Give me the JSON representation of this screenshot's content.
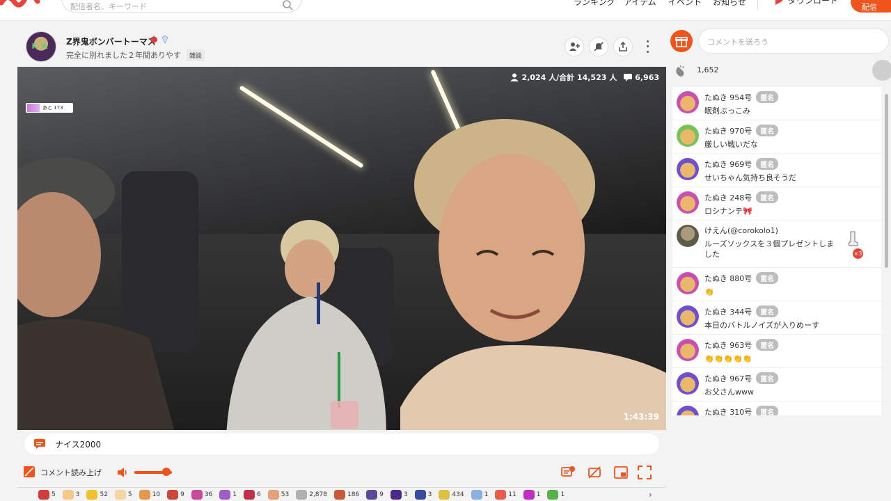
{
  "header": {
    "search_placeholder": "配信者名、キーワード",
    "nav": [
      "ランキング",
      "アイテム",
      "イベント",
      "お知らせ"
    ],
    "download_label": "ダウンロード",
    "live_label": "配信"
  },
  "streamer": {
    "name": "Z界鬼ボンバートーマス",
    "title": "完全に別れました２年間ありやす",
    "genre": "雑談"
  },
  "video": {
    "viewers": "2,024 人/合計 14,523 人",
    "comments": "6,963",
    "badge_text": "あと 173",
    "elapsed": "1:43:39"
  },
  "ticker_comment": "ナイス2000",
  "controls": {
    "read_aloud_label": "コメント読み上げ",
    "volume_level": 0.85
  },
  "items": [
    {
      "icon": "#d23c3c",
      "count": "5"
    },
    {
      "icon": "#f3c88a",
      "count": "3"
    },
    {
      "icon": "#f0c230",
      "count": "52"
    },
    {
      "icon": "#f6d6a0",
      "count": "5"
    },
    {
      "icon": "#e39a4b",
      "count": "10"
    },
    {
      "icon": "#d0453a",
      "count": "9"
    },
    {
      "icon": "#c84a9a",
      "count": "36"
    },
    {
      "icon": "#a05cc8",
      "count": "1"
    },
    {
      "icon": "#c22f4a",
      "count": "6"
    },
    {
      "icon": "#e8a07a",
      "count": "53"
    },
    {
      "icon": "#b0b0b0",
      "count": "2,878"
    },
    {
      "icon": "#c85a3a",
      "count": "186"
    },
    {
      "icon": "#5a4a9a",
      "count": "9"
    },
    {
      "icon": "#4a2a8a",
      "count": "3"
    },
    {
      "icon": "#3a4aa0",
      "count": "3"
    },
    {
      "icon": "#e0c040",
      "count": "434"
    },
    {
      "icon": "#8ab0e0",
      "count": "1"
    },
    {
      "icon": "#e85a4a",
      "count": "11"
    },
    {
      "icon": "#c030c0",
      "count": "1"
    },
    {
      "icon": "#5ab04a",
      "count": "1"
    }
  ],
  "side": {
    "comment_placeholder": "コメントを送ろう",
    "clap_count": "1,652",
    "anon_label": "匿名",
    "comments": [
      {
        "name": "たぬき 954号",
        "text": "眠剤ぶっこみ",
        "avatar": "pink",
        "anon": true
      },
      {
        "name": "たぬき 970号",
        "text": "厳しい戦いだな",
        "avatar": "green",
        "anon": true
      },
      {
        "name": "たぬき 969号",
        "text": "せいちゃん気持ち良そうだ",
        "avatar": "purple",
        "anon": true
      },
      {
        "name": "たぬき 248号",
        "text": "ロシナンテ🎀",
        "avatar": "pink",
        "anon": true
      },
      {
        "name": "けえん(@corokolo1)",
        "text": "ルーズソックスを３個プレゼントしました",
        "avatar": "user",
        "anon": false,
        "gift": "×3"
      },
      {
        "name": "たぬき 880号",
        "text": "👏",
        "avatar": "pink",
        "anon": true
      },
      {
        "name": "たぬき 344号",
        "text": "本日のバトルノイズが入りめーす",
        "avatar": "purple",
        "anon": true
      },
      {
        "name": "たぬき 963号",
        "text": "👏👏👏👏👏",
        "avatar": "pink",
        "anon": true
      },
      {
        "name": "たぬき 967号",
        "text": "お父さんwww",
        "avatar": "purple",
        "anon": true
      },
      {
        "name": "たぬき 310号",
        "text": "",
        "avatar": "purple",
        "anon": true
      }
    ]
  }
}
